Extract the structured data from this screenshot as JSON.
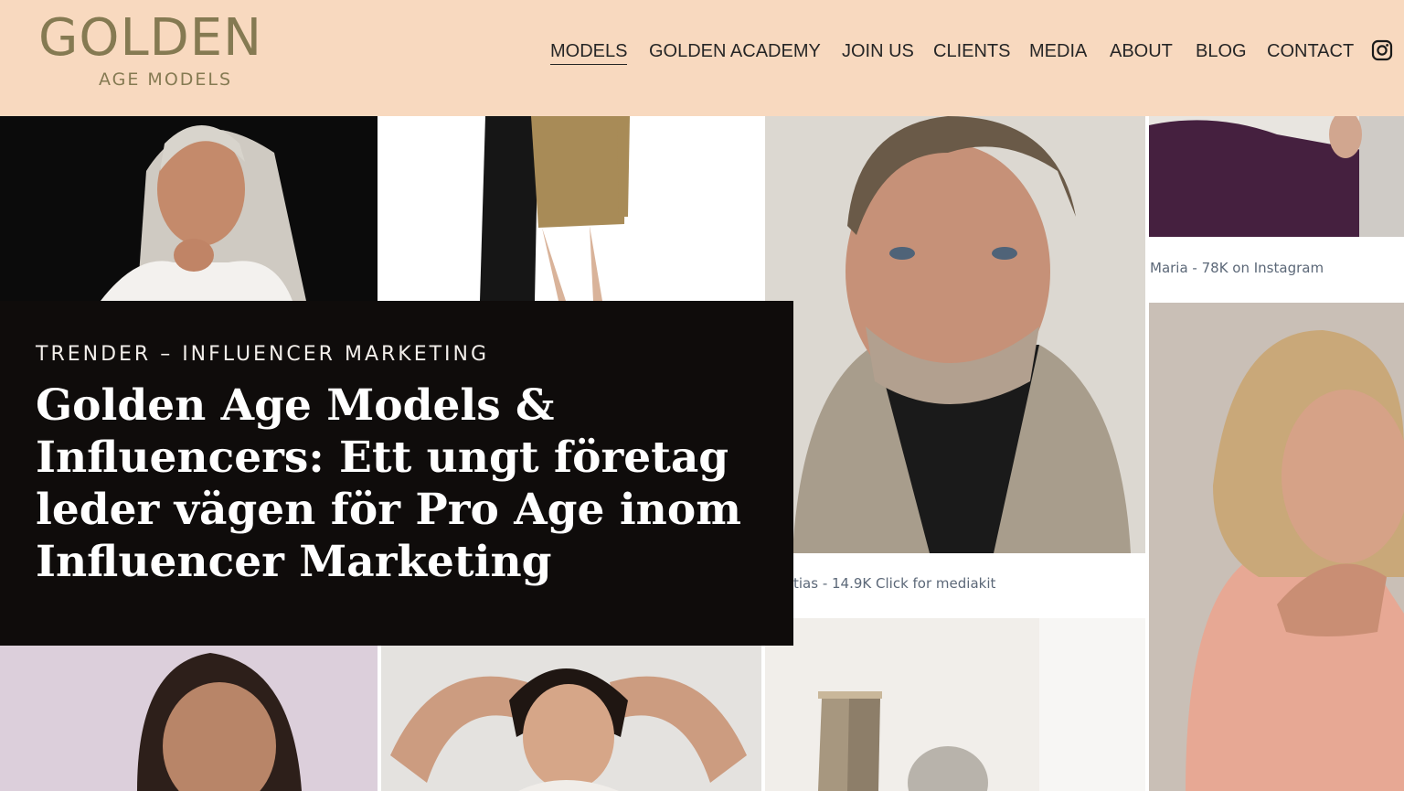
{
  "brand": {
    "logo_main": "GOLDEN",
    "logo_sub": "AGE MODELS",
    "color": "#857a52"
  },
  "header": {
    "background": "#f8d9bf"
  },
  "nav": {
    "items": [
      {
        "label": "MODELS",
        "active": true
      },
      {
        "label": "GOLDEN ACADEMY",
        "active": false
      },
      {
        "label": "JOIN US",
        "active": false
      },
      {
        "label": "CLIENTS",
        "active": false
      },
      {
        "label": "MEDIA",
        "active": false
      },
      {
        "label": "ABOUT",
        "active": false
      },
      {
        "label": "BLOG",
        "active": false
      },
      {
        "label": "CONTACT",
        "active": false
      }
    ],
    "social_icon": "instagram-icon"
  },
  "grid": {
    "captions": {
      "maria": "Maria - 78K on Instagram",
      "mattias": "tias - 14.9K Click for mediakit"
    }
  },
  "article": {
    "kicker": "TRENDER – INFLUENCER MARKETING",
    "headline": "Golden Age Models & Influencers: Ett ungt företag leder vägen för Pro Age inom Influencer Marketing"
  }
}
